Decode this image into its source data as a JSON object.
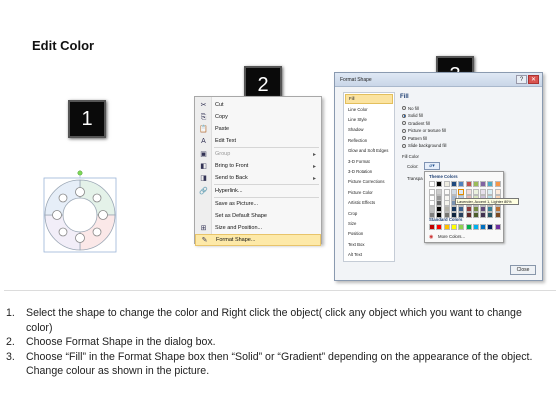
{
  "title": "Edit Color",
  "steps": [
    "1",
    "2",
    "3"
  ],
  "context_menu": {
    "items": [
      {
        "label": "Cut",
        "icon": "scissors-icon",
        "glyph": "✂",
        "disabled": false,
        "arrow": false
      },
      {
        "label": "Copy",
        "icon": "copy-icon",
        "glyph": "⎘",
        "disabled": false,
        "arrow": false
      },
      {
        "label": "Paste",
        "icon": "paste-icon",
        "glyph": "📋",
        "disabled": false,
        "arrow": false
      },
      {
        "label": "Edit Text",
        "icon": "edit-text-icon",
        "glyph": "A",
        "disabled": false,
        "arrow": false
      },
      {
        "label": "Group",
        "icon": "group-icon",
        "glyph": "▣",
        "disabled": true,
        "arrow": true
      },
      {
        "label": "Bring to Front",
        "icon": "bring-front-icon",
        "glyph": "◧",
        "disabled": false,
        "arrow": true
      },
      {
        "label": "Send to Back",
        "icon": "send-back-icon",
        "glyph": "◨",
        "disabled": false,
        "arrow": true
      },
      {
        "label": "Hyperlink...",
        "icon": "hyperlink-icon",
        "glyph": "🔗",
        "disabled": false,
        "arrow": false
      },
      {
        "label": "Save as Picture...",
        "icon": "",
        "glyph": "",
        "disabled": false,
        "arrow": false
      },
      {
        "label": "Set as Default Shape",
        "icon": "",
        "glyph": "",
        "disabled": false,
        "arrow": false
      },
      {
        "label": "Size and Position...",
        "icon": "size-icon",
        "glyph": "⊞",
        "disabled": false,
        "arrow": false
      },
      {
        "label": "Format Shape...",
        "icon": "format-shape-icon",
        "glyph": "✎",
        "disabled": false,
        "arrow": false,
        "highlight": true
      }
    ]
  },
  "dialog": {
    "title": "Format Shape",
    "help": "?",
    "close_glyph": "✕",
    "nav": [
      "Fill",
      "Line Color",
      "Line Style",
      "Shadow",
      "Reflection",
      "Glow and Soft Edges",
      "3-D Format",
      "3-D Rotation",
      "Picture Corrections",
      "Picture Color",
      "Artistic Effects",
      "Crop",
      "Size",
      "Position",
      "Text Box",
      "Alt Text"
    ],
    "pane_heading": "Fill",
    "fill_options": [
      {
        "label": "No fill",
        "selected": false
      },
      {
        "label": "Solid fill",
        "selected": true
      },
      {
        "label": "Gradient fill",
        "selected": false
      },
      {
        "label": "Picture or texture fill",
        "selected": false
      },
      {
        "label": "Pattern fill",
        "selected": false
      },
      {
        "label": "Slide background fill",
        "selected": false
      }
    ],
    "fill_color_label": "Fill Color",
    "color_label": "Color:",
    "transparency_label": "Transpa",
    "close_button": "Close"
  },
  "palette": {
    "theme_label": "Theme Colors",
    "standard_label": "Standard Colors",
    "more_label": "More Colors...",
    "tooltip": "Lavender, Accent 1, Lighter 80%",
    "theme_top": [
      "#ffffff",
      "#000000",
      "#eeece1",
      "#1f497d",
      "#4f81bd",
      "#c0504d",
      "#9bbb59",
      "#8064a2",
      "#4bacc6",
      "#f79646"
    ],
    "standard": [
      "#c00000",
      "#ff0000",
      "#ffc000",
      "#ffff00",
      "#92d050",
      "#00b050",
      "#00b0f0",
      "#0070c0",
      "#002060",
      "#7030a0"
    ]
  },
  "instructions": [
    {
      "num": "1.",
      "text": "Select the shape to change the color and Right click the object( click any object which you want to change color)"
    },
    {
      "num": "2.",
      "text": "Choose Format Shape in the dialog box."
    },
    {
      "num": "3.",
      "text": "Choose “Fill” in the Format Shape box then “Solid” or “Gradient” depending on the appearance of the object. Change colour as shown in the picture."
    }
  ]
}
